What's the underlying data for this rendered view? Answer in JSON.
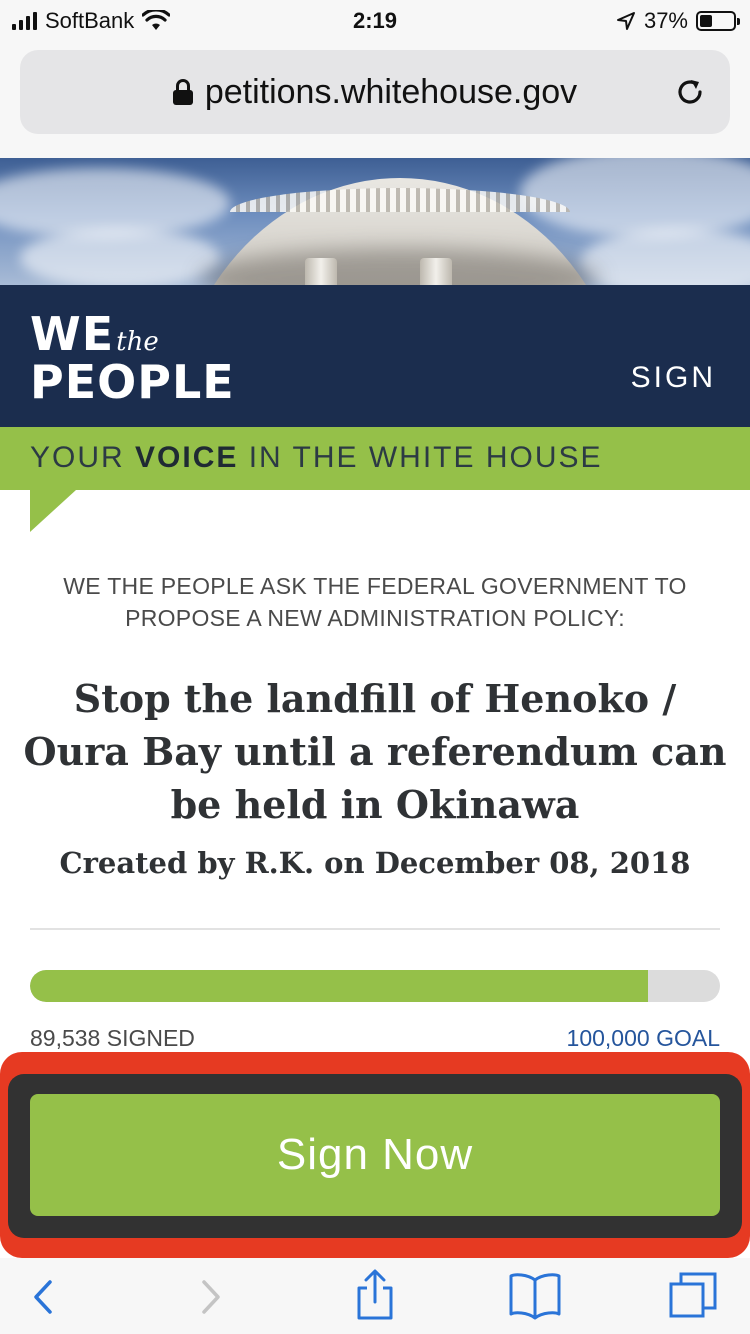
{
  "status_bar": {
    "carrier": "SoftBank",
    "time": "2:19",
    "battery_percent": "37%",
    "battery_level": 0.37
  },
  "browser": {
    "url": "petitions.whitehouse.gov",
    "lock_icon": "lock-icon",
    "reload_icon": "reload-icon"
  },
  "site": {
    "logo_we": "WE",
    "logo_the": "the",
    "logo_people": "PEOPLE",
    "nav_sign": "SIGN",
    "banner_prefix": "YOUR ",
    "banner_bold": "VOICE",
    "banner_suffix": " IN THE WHITE HOUSE",
    "colors": {
      "navy": "#1b2d4e",
      "green": "#95c049",
      "goal_blue": "#25559c",
      "highlight_red": "#e63a22"
    }
  },
  "petition": {
    "intro": "WE THE PEOPLE ASK THE FEDERAL GOVERNMENT TO PROPOSE A NEW ADMINISTRATION POLICY:",
    "title": "Stop the landfill of Henoko / Oura Bay until a referendum can be held in Okinawa",
    "byline": "Created by R.K. on December 08, 2018",
    "signed_label": "89,538 SIGNED",
    "goal_label": "100,000 GOAL",
    "signed_count": 89538,
    "goal_count": 100000
  },
  "cta": {
    "label": "Sign Now"
  },
  "toolbar": {
    "icons": [
      "back-icon",
      "forward-icon",
      "share-icon",
      "bookmarks-icon",
      "tabs-icon"
    ]
  }
}
